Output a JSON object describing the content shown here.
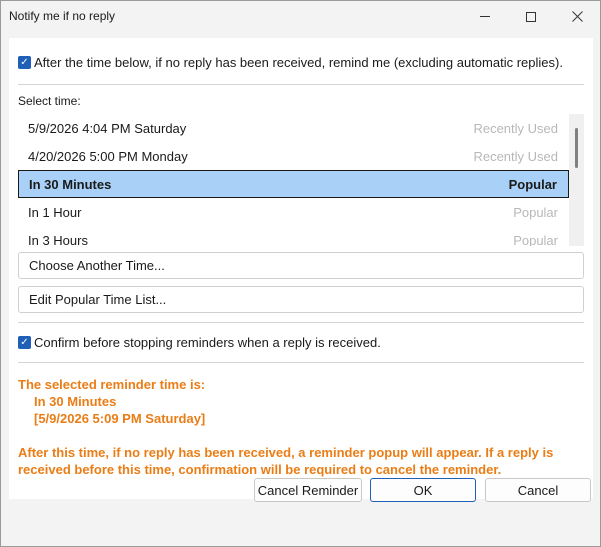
{
  "window": {
    "title": "Notify me if no reply"
  },
  "options": {
    "remind_label": "After the time below, if no reply has been received, remind me (excluding automatic replies).",
    "remind_checked": true,
    "confirm_label": "Confirm before stopping reminders when a reply is received.",
    "confirm_checked": true
  },
  "select_time": {
    "label": "Select time:",
    "items": [
      {
        "time": "5/9/2026 4:04 PM Saturday",
        "hint": "Recently Used",
        "selected": false
      },
      {
        "time": "4/20/2026 5:00 PM Monday",
        "hint": "Recently Used",
        "selected": false
      },
      {
        "time": "In 30 Minutes",
        "hint": "Popular",
        "selected": true
      },
      {
        "time": "In 1 Hour",
        "hint": "Popular",
        "selected": false
      },
      {
        "time": "In 3 Hours",
        "hint": "Popular",
        "selected": false
      }
    ]
  },
  "actions": {
    "choose_another": "Choose Another Time...",
    "edit_popular": "Edit Popular Time List..."
  },
  "summary": {
    "heading": "The selected reminder time is:",
    "time_label": "In 30 Minutes",
    "time_value": "[5/9/2026 5:09 PM Saturday]",
    "note_line1": "After this time, if no reply has been received, a reminder popup will appear. If a reply is",
    "note_line2": "received before this time, confirmation will be required to cancel the reminder."
  },
  "footer": {
    "cancel_reminder": "Cancel Reminder",
    "ok": "OK",
    "cancel": "Cancel"
  },
  "colors": {
    "accent": "#1f5fb8",
    "selection": "#a9d1f7",
    "note": "#ea7d16"
  }
}
